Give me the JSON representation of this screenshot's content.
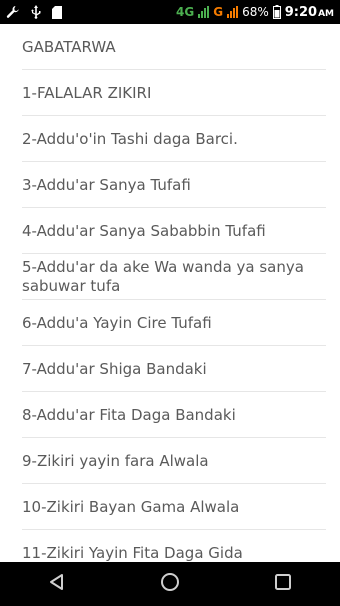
{
  "status_bar": {
    "network_4g": "4G",
    "network_g": "G",
    "battery": "68%",
    "time": "9:20",
    "time_suffix": "AM"
  },
  "list": {
    "items": [
      "GABATARWA",
      "1-FALALAR ZIKIRI",
      "2-Addu'o'in Tashi daga Barci.",
      "3-Addu'ar Sanya Tufafi",
      "4-Addu'ar Sanya Sababbin Tufafi",
      "5-Addu'ar da ake Wa wanda ya sanya sabuwar tufa",
      "6-Addu'a Yayin Cire Tufafi",
      "7-Addu'ar Shiga Bandaki",
      "8-Addu'ar Fita Daga Bandaki",
      "9-Zikiri yayin fara Alwala",
      "10-Zikiri Bayan Gama Alwala",
      "11-Zikiri Yayin Fita Daga Gida"
    ]
  },
  "icons": {
    "wrench": "wrench-icon",
    "usb": "usb-icon",
    "sd": "sd-card-icon",
    "back": "back-icon",
    "home": "home-icon",
    "recents": "recents-icon"
  },
  "colors": {
    "text": "#5a5a5a",
    "divider": "#e6e6e6",
    "bar_bg": "#000000",
    "net_4g": "#4caf50",
    "net_g": "#f57c00"
  }
}
